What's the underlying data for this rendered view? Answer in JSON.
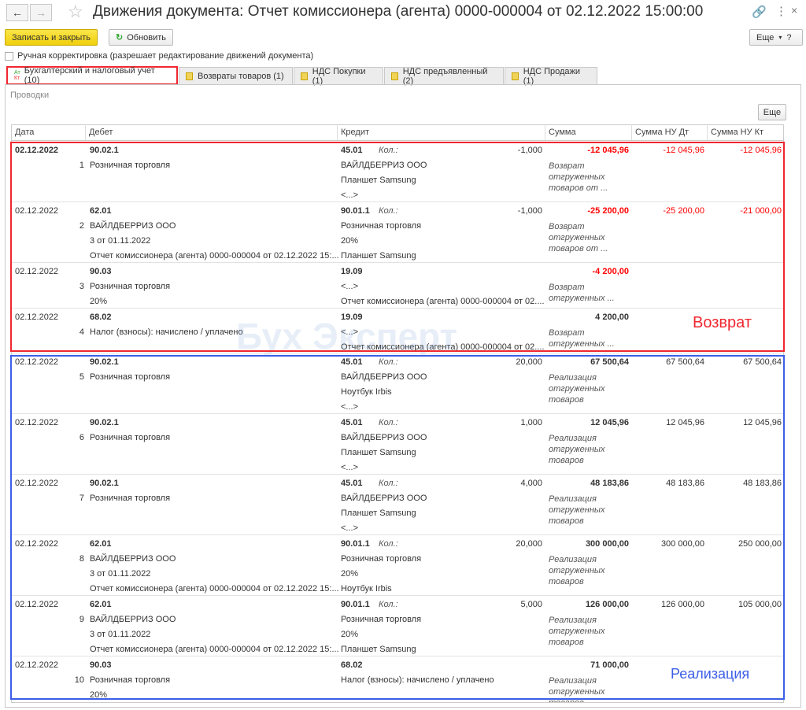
{
  "window": {
    "title": "Движения документа: Отчет комиссионера (агента) 0000-000004 от 02.12.2022 15:00:00"
  },
  "toolbar": {
    "save_close": "Записать и закрыть",
    "refresh": "Обновить",
    "more": "Еще",
    "help": "?"
  },
  "manual": {
    "label": "Ручная корректировка (разрешает редактирование движений документа)",
    "checked": false
  },
  "tabs": [
    {
      "label": "Бухгалтерский и налоговый учет (10)",
      "active": true
    },
    {
      "label": "Возвраты товаров (1)"
    },
    {
      "label": "НДС Покупки (1)"
    },
    {
      "label": "НДС предъявленный (2)"
    },
    {
      "label": "НДС Продажи (1)"
    }
  ],
  "section": {
    "label": "Проводки",
    "more": "Еще"
  },
  "columns": [
    "Дата",
    "Дебет",
    "Кредит",
    "Сумма",
    "Сумма НУ Дт",
    "Сумма НУ Кт"
  ],
  "qty_label": "Кол.:",
  "annotations": {
    "return": "Возврат",
    "sale": "Реализация"
  },
  "watermark": "БухЭксперт8",
  "rows": [
    {
      "date": "02.12.2022",
      "n": "1",
      "debit": [
        "90.02.1",
        "Розничная торговля"
      ],
      "credit": [
        "45.01",
        "ВАЙЛДБЕРРИЗ ООО",
        "Планшет Samsung",
        "<...>"
      ],
      "qty": "-1,000",
      "sum": "-12 045,96",
      "dt": "-12 045,96",
      "kt": "-12 045,96",
      "content": [
        "Возврат",
        "отгруженных",
        "товаров от ..."
      ],
      "red": true,
      "bold_date": true
    },
    {
      "date": "02.12.2022",
      "n": "2",
      "debit": [
        "62.01",
        "ВАЙЛДБЕРРИЗ ООО",
        "3 от 01.11.2022",
        "Отчет комиссионера (агента) 0000-000004 от 02.12.2022 15:..."
      ],
      "credit": [
        "90.01.1",
        "Розничная торговля",
        "20%",
        "Планшет Samsung"
      ],
      "qty": "-1,000",
      "sum": "-25 200,00",
      "dt": "-25 200,00",
      "kt": "-21 000,00",
      "content": [
        "Возврат",
        "отгруженных",
        "товаров от ..."
      ],
      "red": true
    },
    {
      "date": "02.12.2022",
      "n": "3",
      "debit": [
        "90.03",
        "Розничная торговля",
        "20%"
      ],
      "credit": [
        "19.09",
        "<...>",
        "Отчет комиссионера (агента) 0000-000004 от 02...."
      ],
      "qty": "",
      "sum": "-4 200,00",
      "dt": "",
      "kt": "",
      "content": [
        "Возврат",
        "отгруженных ..."
      ],
      "red": true
    },
    {
      "date": "02.12.2022",
      "n": "4",
      "debit": [
        "68.02",
        "Налог (взносы): начислено / уплачено"
      ],
      "credit": [
        "19.09",
        "<...>",
        "Отчет комиссионера (агента) 0000-000004 от 02...."
      ],
      "qty": "",
      "sum": "4 200,00",
      "dt": "",
      "kt": "",
      "content": [
        "Возврат",
        "отгруженных ..."
      ]
    },
    {
      "date": "02.12.2022",
      "n": "5",
      "debit": [
        "90.02.1",
        "Розничная торговля"
      ],
      "credit": [
        "45.01",
        "ВАЙЛДБЕРРИЗ ООО",
        "Ноутбук Irbis",
        "<...>"
      ],
      "qty": "20,000",
      "sum": "67 500,64",
      "dt": "67 500,64",
      "kt": "67 500,64",
      "content": [
        "Реализация",
        "отгруженных",
        "товаров"
      ]
    },
    {
      "date": "02.12.2022",
      "n": "6",
      "debit": [
        "90.02.1",
        "Розничная торговля"
      ],
      "credit": [
        "45.01",
        "ВАЙЛДБЕРРИЗ ООО",
        "Планшет Samsung",
        "<...>"
      ],
      "qty": "1,000",
      "sum": "12 045,96",
      "dt": "12 045,96",
      "kt": "12 045,96",
      "content": [
        "Реализация",
        "отгруженных",
        "товаров"
      ]
    },
    {
      "date": "02.12.2022",
      "n": "7",
      "debit": [
        "90.02.1",
        "Розничная торговля"
      ],
      "credit": [
        "45.01",
        "ВАЙЛДБЕРРИЗ ООО",
        "Планшет Samsung",
        "<...>"
      ],
      "qty": "4,000",
      "sum": "48 183,86",
      "dt": "48 183,86",
      "kt": "48 183,86",
      "content": [
        "Реализация",
        "отгруженных",
        "товаров"
      ]
    },
    {
      "date": "02.12.2022",
      "n": "8",
      "debit": [
        "62.01",
        "ВАЙЛДБЕРРИЗ ООО",
        "3 от 01.11.2022",
        "Отчет комиссионера (агента) 0000-000004 от 02.12.2022 15:..."
      ],
      "credit": [
        "90.01.1",
        "Розничная торговля",
        "20%",
        "Ноутбук Irbis"
      ],
      "qty": "20,000",
      "sum": "300 000,00",
      "dt": "300 000,00",
      "kt": "250 000,00",
      "content": [
        "Реализация",
        "отгруженных",
        "товаров"
      ]
    },
    {
      "date": "02.12.2022",
      "n": "9",
      "debit": [
        "62.01",
        "ВАЙЛДБЕРРИЗ ООО",
        "3 от 01.11.2022",
        "Отчет комиссионера (агента) 0000-000004 от 02.12.2022 15:..."
      ],
      "credit": [
        "90.01.1",
        "Розничная торговля",
        "20%",
        "Планшет Samsung"
      ],
      "qty": "5,000",
      "sum": "126 000,00",
      "dt": "126 000,00",
      "kt": "105 000,00",
      "content": [
        "Реализация",
        "отгруженных",
        "товаров"
      ]
    },
    {
      "date": "02.12.2022",
      "n": "10",
      "debit": [
        "90.03",
        "Розничная торговля",
        "20%"
      ],
      "credit": [
        "68.02",
        "Налог (взносы): начислено / уплачено"
      ],
      "qty": "",
      "sum": "71 000,00",
      "dt": "",
      "kt": "",
      "content": [
        "Реализация",
        "отгруженных",
        "товаров"
      ]
    }
  ],
  "colors": {
    "accent": "#f5d80f",
    "negative": "#ff0000",
    "return_box": "#f0262f",
    "sale_box": "#3c5ee6"
  }
}
